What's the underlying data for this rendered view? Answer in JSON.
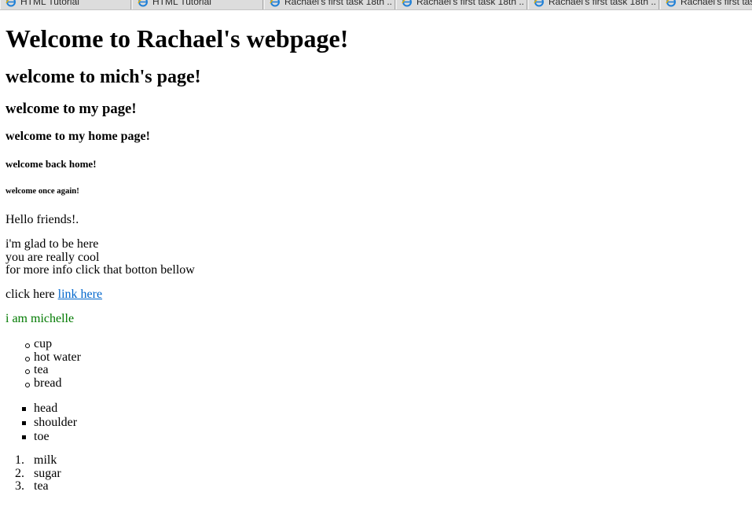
{
  "tabs": [
    {
      "label": "HTML Tutorial",
      "icon": "ie-browser-icon"
    },
    {
      "label": "HTML Tutorial",
      "icon": "ie-browser-icon"
    },
    {
      "label": "Rachael's first task 18th ...",
      "icon": "ie-browser-icon"
    },
    {
      "label": "Rachael's first task 18th ...",
      "icon": "ie-browser-icon"
    },
    {
      "label": "Rachael's first task 18th ...",
      "icon": "ie-browser-icon"
    },
    {
      "label": "Rachael's first tas",
      "icon": "ie-browser-icon"
    }
  ],
  "page": {
    "h1": "Welcome to Rachael's webpage!",
    "h2": "welcome to mich's page!",
    "h3": "welcome to my page!",
    "h4": "welcome to my home page!",
    "h5": "welcome back home!",
    "h6": "welcome once again!",
    "hello": "Hello friends!.",
    "lines": [
      "i'm glad to be here",
      "you are really cool",
      "for more info click that botton bellow"
    ],
    "click_prefix": "click here ",
    "link_text": "link here",
    "michelle": "i am michelle",
    "list_circle": [
      "cup",
      "hot water",
      "tea",
      "bread"
    ],
    "list_square": [
      "head",
      "shoulder",
      "toe"
    ],
    "list_ordered": [
      "milk",
      "sugar",
      "tea"
    ]
  },
  "colors": {
    "link": "#0066cc",
    "green_text": "#007a00",
    "tab_strip": "#dcdcdc"
  }
}
